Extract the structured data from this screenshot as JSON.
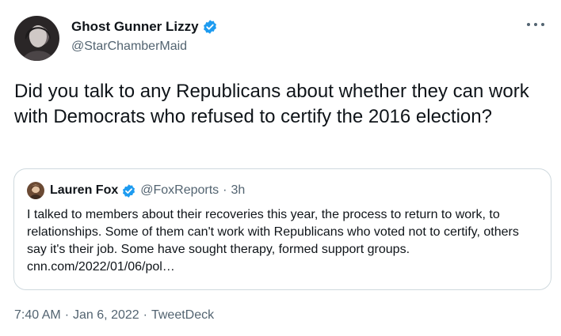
{
  "tweet": {
    "author": {
      "display_name": "Ghost Gunner Lizzy",
      "handle": "@StarChamberMaid",
      "verified": true
    },
    "text": "Did you talk to any Republicans about whether they can work with Democrats who refused to certify the 2016 election?",
    "more_icon": "more-horizontal-icon"
  },
  "quote": {
    "author": {
      "display_name": "Lauren Fox",
      "handle": "@FoxReports",
      "verified": true
    },
    "separator": "·",
    "time": "3h",
    "text": "I talked to members about their recoveries this year, the process to return to work, to relationships. Some of them can't work with Republicans who voted not to certify, others say it's their job. Some have sought therapy, formed support groups. cnn.com/2022/01/06/pol…"
  },
  "meta": {
    "time": "7:40 AM",
    "separator": "·",
    "date": "Jan 6, 2022",
    "source": "TweetDeck"
  },
  "colors": {
    "verified_blue": "#1d9bf0",
    "secondary_text": "#536471",
    "border": "#cfd9de"
  }
}
